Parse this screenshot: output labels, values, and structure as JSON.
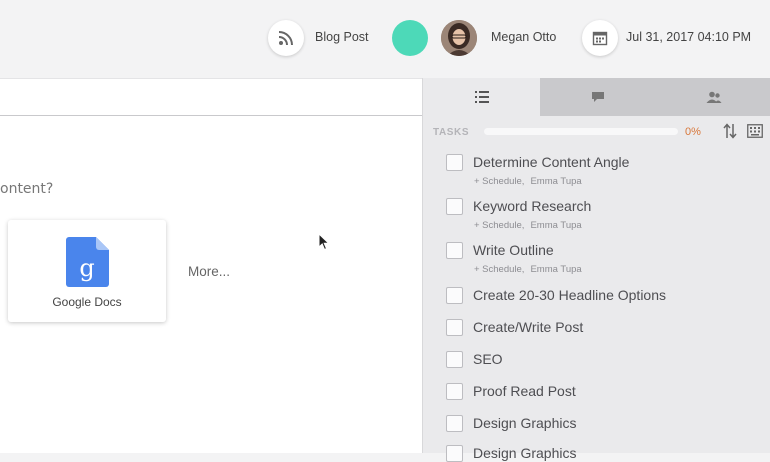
{
  "header": {
    "content_type": "Blog Post",
    "user_name": "Megan Otto",
    "datetime": "Jul 31, 2017 04:10 PM"
  },
  "main": {
    "question": "ontent?",
    "integration_label": "Google Docs",
    "more_label": "More..."
  },
  "panel": {
    "tabs": [
      {
        "icon": "list-icon",
        "active": true
      },
      {
        "icon": "comment-icon",
        "active": false
      },
      {
        "icon": "people-icon",
        "active": false
      }
    ],
    "tasks_heading": "TASKS",
    "progress_fraction": 0,
    "progress_label": "0%",
    "tasks": [
      {
        "title": "Determine Content Angle",
        "schedule": "+ Schedule,",
        "assignee": "Emma Tupa"
      },
      {
        "title": "Keyword Research",
        "schedule": "+ Schedule,",
        "assignee": "Emma Tupa"
      },
      {
        "title": "Write Outline",
        "schedule": "+ Schedule,",
        "assignee": "Emma Tupa"
      },
      {
        "title": "Create 20-30 Headline Options"
      },
      {
        "title": "Create/Write Post"
      },
      {
        "title": "SEO"
      },
      {
        "title": "Proof Read Post"
      },
      {
        "title": "Design Graphics"
      },
      {
        "title": "Design Graphics"
      }
    ]
  },
  "colors": {
    "accent_teal": "#4dd9b8",
    "progress_orange": "#e37a3a",
    "google_blue": "#4a85ec"
  }
}
